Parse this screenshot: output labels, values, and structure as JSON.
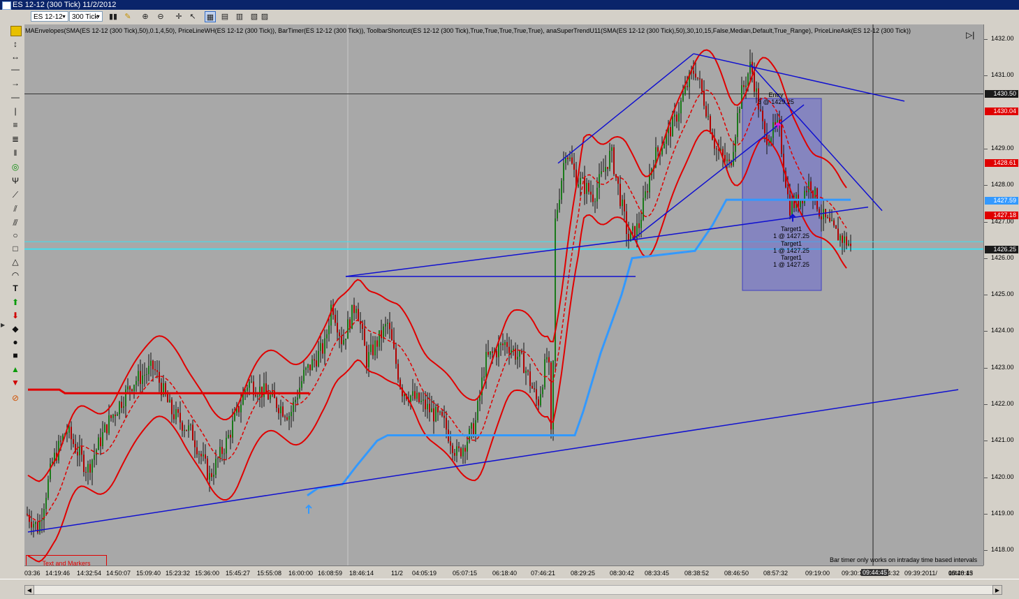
{
  "window": {
    "title": "ES 12-12 (300 Tick)  11/2/2012"
  },
  "toolbar": {
    "instrument": "ES 12-12",
    "interval": "300 Tick"
  },
  "indicator_line": "MAEnvelopes(SMA(ES 12-12 (300 Tick),50),0.1,4,50), PriceLineWH(ES 12-12 (300 Tick)), BarTimer(ES 12-12 (300 Tick)), ToolbarShortcut(ES 12-12 (300 Tick),True,True,True,True,True), anaSuperTrendU11(SMA(ES 12-12 (300 Tick),50),30,10,15,False,Median,Default,True_Range), PriceLineAsk(ES 12-12 (300 Tick))",
  "price_axis": {
    "ticks": [
      "1432.00",
      "1431.00",
      "1429.00",
      "1428.00",
      "1427.00",
      "1426.00",
      "1425.00",
      "1424.00",
      "1423.00",
      "1422.00",
      "1421.00",
      "1420.00",
      "1419.00",
      "1418.00"
    ],
    "tags": [
      {
        "label": "1430.50",
        "color": "#1a1a1a",
        "price": 1430.5
      },
      {
        "label": "1430.04",
        "color": "#e00000",
        "price": 1430.04
      },
      {
        "label": "1428.61",
        "color": "#e00000",
        "price": 1428.61
      },
      {
        "label": "1427.59",
        "color": "#3399ff",
        "price": 1427.59
      },
      {
        "label": "1427.18",
        "color": "#e00000",
        "price": 1427.18
      },
      {
        "label": "1426.25",
        "color": "#1a1a1a",
        "price": 1426.25
      }
    ]
  },
  "time_axis": {
    "ticks": [
      "03:36",
      "14:19:46",
      "14:32:54",
      "14:50:07",
      "15:09:40",
      "15:23:32",
      "15:36:00",
      "15:45:27",
      "15:55:08",
      "16:00:00",
      "16:08:59",
      "18:46:14",
      "11/2",
      "04:05:19",
      "05:07:15",
      "06:18:40",
      "07:46:21",
      "08:29:25",
      "08:30:42",
      "08:33:45",
      "08:38:52",
      "08:46:50",
      "08:57:32",
      "09:19:00",
      "09:30:13",
      "09:34:32",
      "09:39:20",
      "11/",
      "1/4",
      "00:20:15",
      "05:48:43"
    ],
    "cursor": "09:44:45"
  },
  "annotations": {
    "entry_label": "Entry",
    "entry_detail": "3 @ 1429.25",
    "targets": [
      {
        "label": "Target1",
        "detail": "1 @ 1427.25"
      },
      {
        "label": "Target1",
        "detail": "1 @ 1427.25"
      },
      {
        "label": "Target1",
        "detail": "1 @ 1427.25"
      }
    ],
    "text_and_markers": "Text and Markers",
    "bar_timer_note": "Bar timer only works on intraday time based intervals"
  },
  "colors": {
    "chart_bg": "#a8a8a8",
    "trendline": "#1010d0",
    "envelope": "#e00000",
    "supertrend": "#3399ff",
    "cyan_lines": "#40e0f0",
    "highlight_box": "rgba(90,90,220,0.45)"
  },
  "icons": [
    "trade-arrow-up-icon",
    "play-end-icon"
  ]
}
